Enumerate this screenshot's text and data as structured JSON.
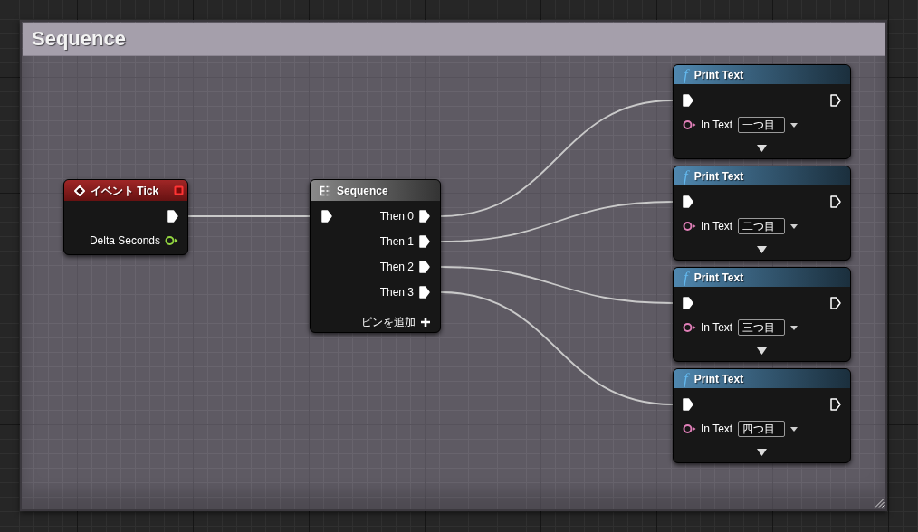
{
  "comment": {
    "title": "Sequence"
  },
  "event_node": {
    "title": "イベント Tick",
    "output_label": "Delta Seconds"
  },
  "sequence_node": {
    "title": "Sequence",
    "outputs": [
      "Then 0",
      "Then 1",
      "Then 2",
      "Then 3"
    ],
    "add_pin_label": "ピンを追加"
  },
  "print_nodes": [
    {
      "icon": "f",
      "title": "Print Text",
      "input_label": "In Text",
      "value": "一つ目"
    },
    {
      "icon": "f",
      "title": "Print Text",
      "input_label": "In Text",
      "value": "二つ目"
    },
    {
      "icon": "f",
      "title": "Print Text",
      "input_label": "In Text",
      "value": "三つ目"
    },
    {
      "icon": "f",
      "title": "Print Text",
      "input_label": "In Text",
      "value": "四つ目"
    }
  ]
}
